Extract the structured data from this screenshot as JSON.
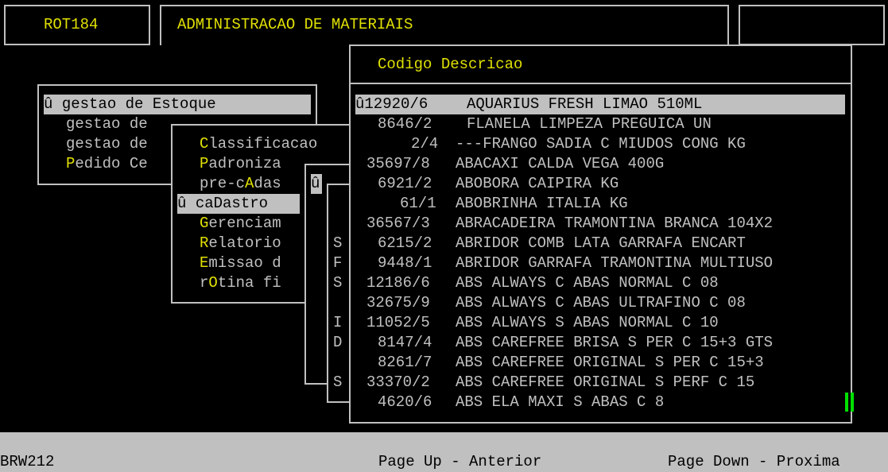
{
  "header": {
    "routine": "ROT184",
    "title": "ADMINISTRACAO DE MATERIAIS"
  },
  "menu1": {
    "items": [
      {
        "marker": "û",
        "label": "gestao de Estoque"
      },
      {
        "label": "gestao de"
      },
      {
        "label": "gestao de"
      },
      {
        "label": "Pedido Ce"
      }
    ]
  },
  "menu2": {
    "items": [
      {
        "label": "Classificacao"
      },
      {
        "label": "Padroniza"
      },
      {
        "label": "pre-cAdas"
      },
      {
        "marker": "û",
        "label": "caDastro"
      },
      {
        "label": "Gerenciam"
      },
      {
        "label": "Relatorio"
      },
      {
        "label": "Emissao d"
      },
      {
        "label": "rOtina fi"
      }
    ]
  },
  "menu3": {
    "marker": "û",
    "letters": [
      "S",
      "F",
      "S",
      "I",
      "D",
      "S"
    ]
  },
  "lookup": {
    "header": "Codigo Descricao",
    "rows": [
      {
        "code": "û12920/6",
        "desc": "AQUARIUS FRESH LIMAO 510ML"
      },
      {
        "code": "8646/2",
        "desc": "FLANELA LIMPEZA PREGUICA UN"
      },
      {
        "code": "2/4",
        "desc": "---FRANGO SADIA C MIUDOS CONG KG"
      },
      {
        "code": "35697/8",
        "desc": "ABACAXI CALDA VEGA 400G"
      },
      {
        "code": "6921/2",
        "desc": "ABOBORA CAIPIRA KG"
      },
      {
        "code": "61/1",
        "desc": "ABOBRINHA ITALIA KG"
      },
      {
        "code": "36567/3",
        "desc": "ABRACADEIRA TRAMONTINA BRANCA 104X2"
      },
      {
        "code": "6215/2",
        "desc": "ABRIDOR COMB LATA GARRAFA ENCART"
      },
      {
        "code": "9448/1",
        "desc": "ABRIDOR GARRAFA TRAMONTINA MULTIUSO"
      },
      {
        "code": "12186/6",
        "desc": "ABS ALWAYS C ABAS NORMAL C 08"
      },
      {
        "code": "32675/9",
        "desc": "ABS ALWAYS C ABAS ULTRAFINO C 08"
      },
      {
        "code": "11052/5",
        "desc": "ABS ALWAYS S ABAS NORMAL C 10"
      },
      {
        "code": "8147/4",
        "desc": "ABS CAREFREE BRISA S PER C 15+3 GTS"
      },
      {
        "code": "8261/7",
        "desc": "ABS CAREFREE ORIGINAL S PER C 15+3"
      },
      {
        "code": "33370/2",
        "desc": "ABS CAREFREE ORIGINAL S PERF C 15"
      },
      {
        "code": "4620/6",
        "desc": "ABS ELA MAXI S ABAS C 8"
      }
    ]
  },
  "status": {
    "program": "BRW212",
    "page_up": "Page Up - Anterior",
    "page_down": "Page Down - Proxima"
  },
  "colors": {
    "background": "#000000",
    "text": "#c0c0c0",
    "highlight_letter": "#e0e000",
    "selection_bg": "#c0c0c0",
    "scroll_thumb": "#00e000"
  }
}
